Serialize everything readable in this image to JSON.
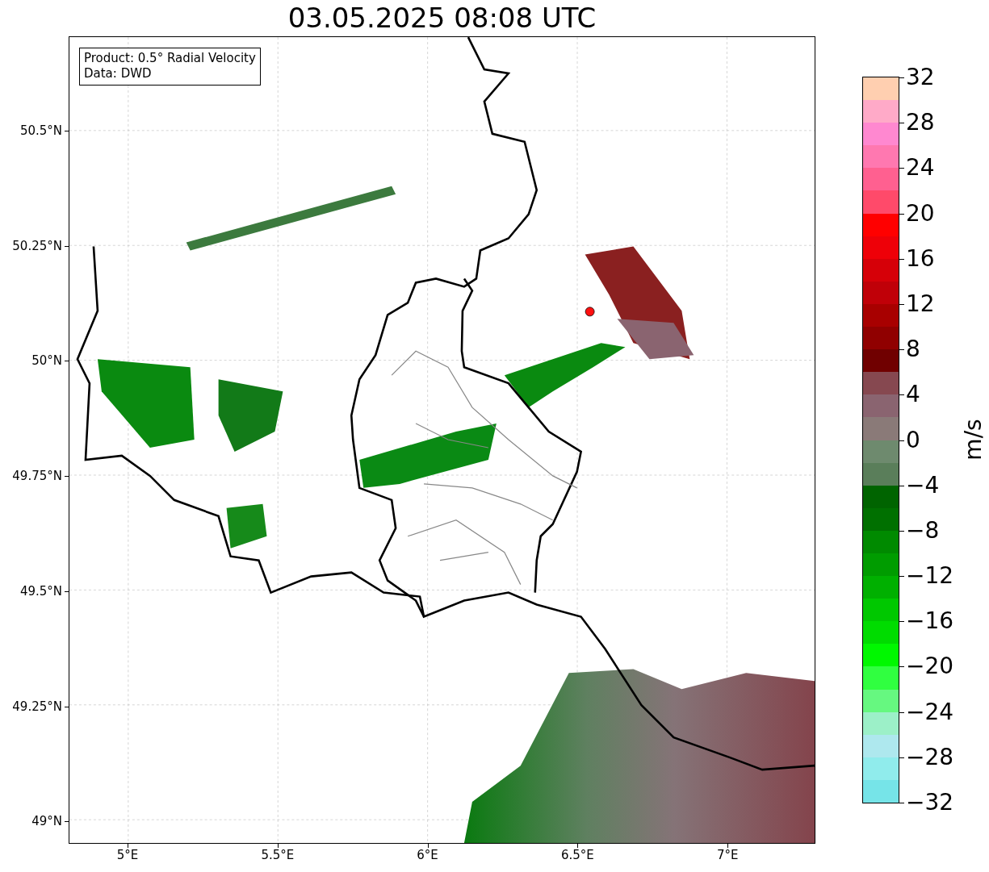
{
  "title": "03.05.2025 08:08 UTC",
  "info_box": {
    "lines": [
      "Product: 0.5° Radial Velocity",
      "Data: DWD"
    ]
  },
  "map": {
    "y_ticks": [
      "50.5°N",
      "50.25°N",
      "50°N",
      "49.75°N",
      "49.5°N",
      "49.25°N",
      "49°N"
    ],
    "x_ticks": [
      "5°E",
      "5.5°E",
      "6°E",
      "6.5°E",
      "7°E"
    ]
  },
  "colorbar": {
    "label": "m/s",
    "ticks": [
      "32",
      "28",
      "24",
      "20",
      "16",
      "12",
      "8",
      "4",
      "0",
      "−4",
      "−8",
      "−12",
      "−16",
      "−20",
      "−24",
      "−28",
      "−32"
    ],
    "segments": [
      {
        "color": "#ffcfb0"
      },
      {
        "color": "#ffaac8"
      },
      {
        "color": "#ff88d0"
      },
      {
        "color": "#ff78b0"
      },
      {
        "color": "#ff6090"
      },
      {
        "color": "#ff4a6a"
      },
      {
        "color": "#ff0000"
      },
      {
        "color": "#ee0008"
      },
      {
        "color": "#d60008"
      },
      {
        "color": "#c00008"
      },
      {
        "color": "#a80000"
      },
      {
        "color": "#900000"
      },
      {
        "color": "#700000"
      },
      {
        "color": "#864850"
      },
      {
        "color": "#8a6470"
      },
      {
        "color": "#8a7a78"
      },
      {
        "color": "#6e8a6e"
      },
      {
        "color": "#5a7e5a"
      },
      {
        "color": "#006400"
      },
      {
        "color": "#007000"
      },
      {
        "color": "#008a00"
      },
      {
        "color": "#009c00"
      },
      {
        "color": "#00b000"
      },
      {
        "color": "#00c800"
      },
      {
        "color": "#00dc00"
      },
      {
        "color": "#00f800"
      },
      {
        "color": "#30ff40"
      },
      {
        "color": "#66f880"
      },
      {
        "color": "#9cf0c8"
      },
      {
        "color": "#aee8ee"
      },
      {
        "color": "#90ecec"
      },
      {
        "color": "#76e4e8"
      }
    ]
  }
}
